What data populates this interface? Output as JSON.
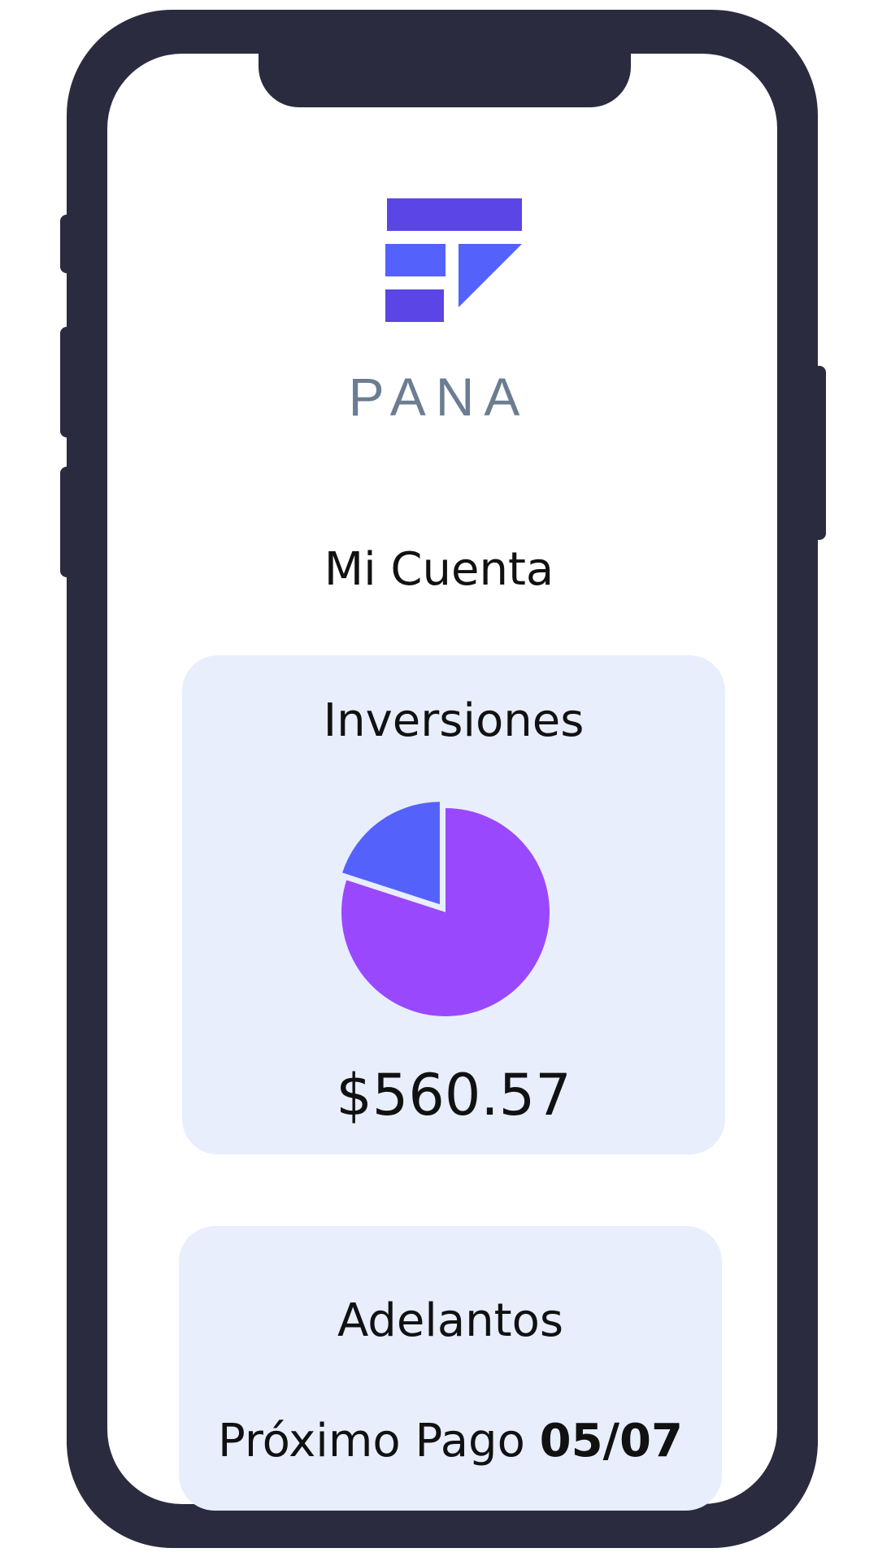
{
  "brand": {
    "name": "PANA",
    "colors": {
      "dark": "#5b45e6",
      "light": "#5462fb"
    }
  },
  "device": {
    "frame_color": "#2b2b40"
  },
  "page": {
    "title": "Mi Cuenta"
  },
  "investments": {
    "title": "Inversiones",
    "amount": "$560.57",
    "pie_icon": "pie-chart-icon",
    "slices": [
      {
        "share": 0.8,
        "color": "#9a48fe"
      },
      {
        "share": 0.2,
        "color": "#5462fb"
      }
    ]
  },
  "advances": {
    "title": "Adelantos",
    "next_payment_label": "Próximo Pago",
    "next_payment_date": "05/07"
  },
  "card_background": "#e8eefc"
}
